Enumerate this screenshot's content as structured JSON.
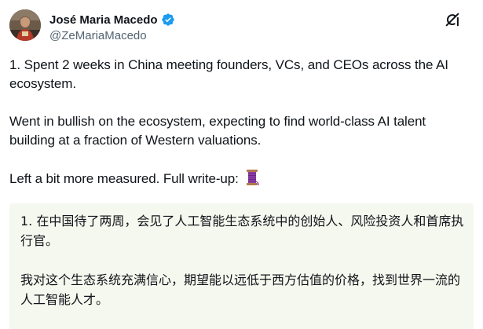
{
  "author": {
    "display_name": "José Maria Macedo",
    "handle": "@ZeMariaMacedo",
    "verified_color": "#1d9bf0"
  },
  "header": {
    "grok_icon": "grok-icon"
  },
  "tweet": {
    "paragraph_1": "1. Spent 2 weeks in China meeting founders, VCs, and CEOs across the AI ecosystem.",
    "paragraph_2": "Went in bullish on the ecosystem, expecting to find world-class AI talent building at a fraction of Western valuations.",
    "paragraph_3": "Left a bit more measured. Full write-up: ",
    "emoji": "spool-of-thread-emoji"
  },
  "translation": {
    "background_color": "#f5f8ee",
    "paragraph_1": "1. 在中国待了两周，会见了人工智能生态系统中的创始人、风险投资人和首席执行官。",
    "paragraph_2": "我对这个生态系统充满信心，期望能以远低于西方估值的价格，找到世界一流的人工智能人才。"
  }
}
